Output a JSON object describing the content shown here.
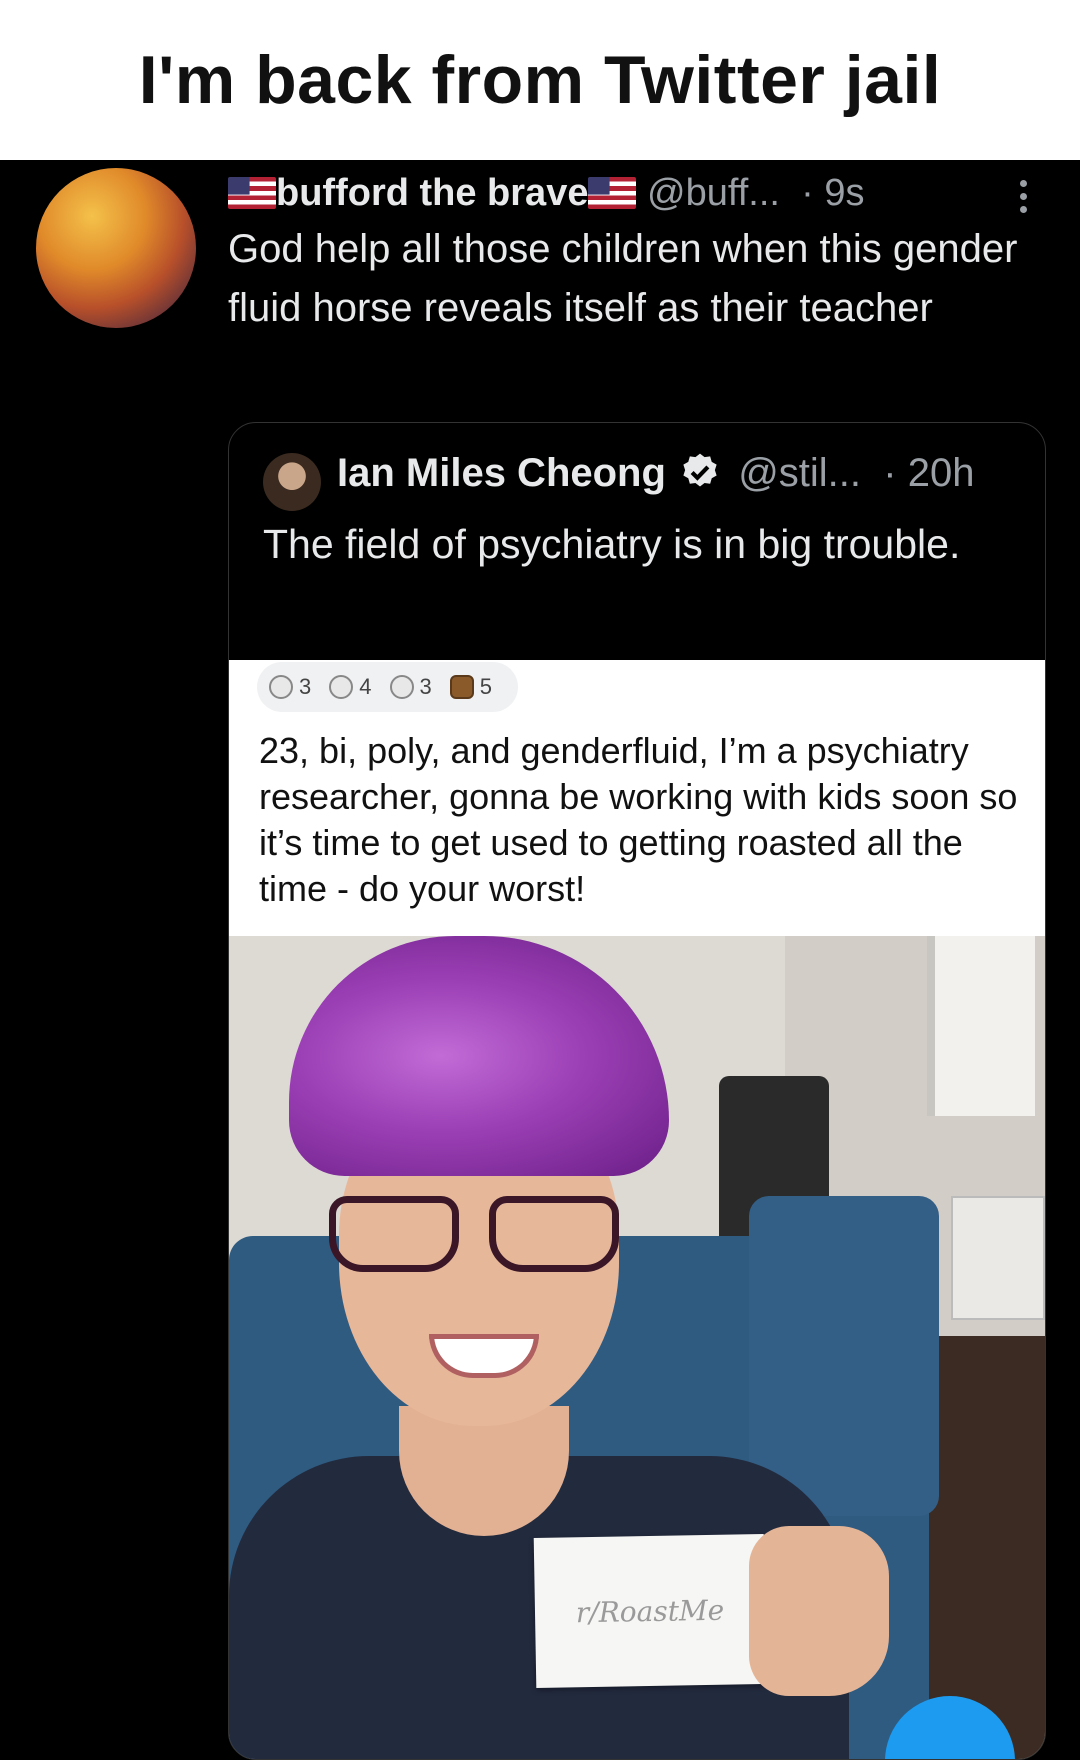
{
  "meme": {
    "title": "I'm back from Twitter jail"
  },
  "tweet": {
    "display_name": "bufford the brave",
    "handle": "@buff...",
    "separator": "·",
    "time": "9s",
    "text": "God help all those children when this gender fluid horse reveals itself as their teacher",
    "avatar_icon": "cartoon-character-avatar",
    "more_icon": "more-vertical-icon",
    "flag_icon": "us-flag-icon"
  },
  "quote": {
    "display_name": "Ian Miles Cheong",
    "handle": "@stil...",
    "separator": "·",
    "time": "20h",
    "text": "The field of psychiatry is in big trouble.",
    "verified_icon": "verified-badge-icon",
    "embedded_post": {
      "award_counts": [
        "3",
        "4",
        "3",
        "5"
      ],
      "text": "23, bi, poly, and genderfluid, I’m a psychiatry researcher, gonna be working with kids soon so it’s time to get used to getting roasted all the time - do your worst!",
      "sign_text": "r/RoastMe"
    }
  },
  "colors": {
    "background": "#000000",
    "text": "#e7e9ea",
    "muted": "#9aa0a6",
    "accent": "#1d9bf0"
  }
}
